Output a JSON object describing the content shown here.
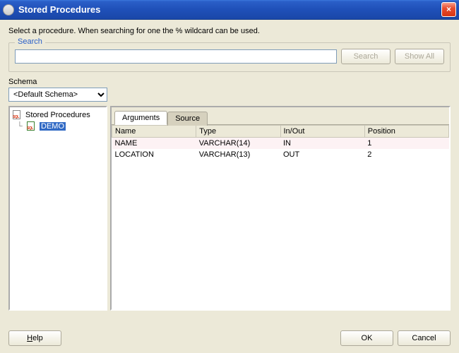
{
  "window": {
    "title": "Stored Procedures",
    "close_icon": "×"
  },
  "instructions": "Select a procedure. When searching for one the % wildcard can be used.",
  "search": {
    "legend": "Search",
    "value": "",
    "placeholder": "",
    "search_button": "Search",
    "show_all_button": "Show All"
  },
  "schema": {
    "label": "Schema",
    "selected": "<Default Schema>"
  },
  "tree": {
    "root": "Stored Procedures",
    "items": [
      {
        "label": "DEMO",
        "selected": true
      }
    ]
  },
  "tabs": {
    "arguments": "Arguments",
    "source": "Source",
    "active": "arguments"
  },
  "args_table": {
    "columns": [
      "Name",
      "Type",
      "In/Out",
      "Position"
    ],
    "rows": [
      {
        "name": "NAME",
        "type": "VARCHAR(14)",
        "inout": "IN",
        "position": "1"
      },
      {
        "name": "LOCATION",
        "type": "VARCHAR(13)",
        "inout": "OUT",
        "position": "2"
      }
    ]
  },
  "footer": {
    "help": "Help",
    "ok": "OK",
    "cancel": "Cancel"
  }
}
